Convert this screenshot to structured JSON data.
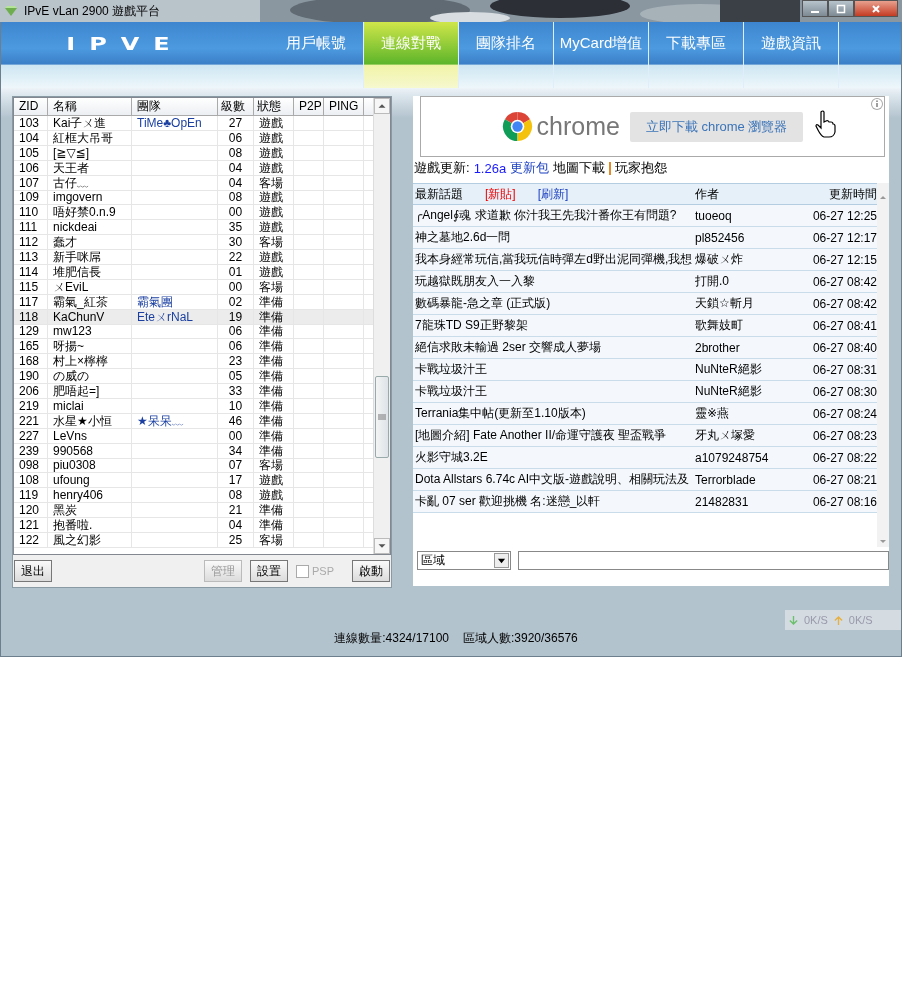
{
  "window": {
    "title": "IPvE vLan 2900 遊戲平台"
  },
  "logo": "IPVE",
  "nav_tabs": [
    {
      "label": "用戶帳號",
      "selected": false
    },
    {
      "label": "連線對戰",
      "selected": true
    },
    {
      "label": "團隊排名",
      "selected": false
    },
    {
      "label": "MyCard增值",
      "selected": false
    },
    {
      "label": "下載專區",
      "selected": false
    },
    {
      "label": "遊戲資訊",
      "selected": false
    }
  ],
  "players": {
    "columns": [
      "ZID",
      "名稱",
      "團隊",
      "級數",
      "狀態",
      "P2P",
      "PING"
    ],
    "rows": [
      {
        "zid": "103",
        "name": "Kai子ㄨ進",
        "team": "TiMe♣OpEn",
        "level": "27",
        "status": "遊戲",
        "selected": false
      },
      {
        "zid": "104",
        "name": "紅框大吊哥",
        "team": "",
        "level": "06",
        "status": "遊戲",
        "selected": false
      },
      {
        "zid": "105",
        "name": "[≧▽≦]",
        "team": "",
        "level": "08",
        "status": "遊戲",
        "selected": false
      },
      {
        "zid": "106",
        "name": "天王者",
        "team": "",
        "level": "04",
        "status": "遊戲",
        "selected": false
      },
      {
        "zid": "107",
        "name": "古仔﹏",
        "team": "",
        "level": "04",
        "status": "客場",
        "selected": false
      },
      {
        "zid": "109",
        "name": "imgovern",
        "team": "",
        "level": "08",
        "status": "遊戲",
        "selected": false
      },
      {
        "zid": "110",
        "name": "唔好禁0.n.9",
        "team": "",
        "level": "00",
        "status": "遊戲",
        "selected": false
      },
      {
        "zid": "111",
        "name": "nickdeai",
        "team": "",
        "level": "35",
        "status": "遊戲",
        "selected": false
      },
      {
        "zid": "112",
        "name": "蠢才",
        "team": "",
        "level": "30",
        "status": "客場",
        "selected": false
      },
      {
        "zid": "113",
        "name": "新手咪屌",
        "team": "",
        "level": "22",
        "status": "遊戲",
        "selected": false
      },
      {
        "zid": "114",
        "name": "堆肥信長",
        "team": "",
        "level": "01",
        "status": "遊戲",
        "selected": false
      },
      {
        "zid": "115",
        "name": "ㄨEviL",
        "team": "",
        "level": "00",
        "status": "客場",
        "selected": false
      },
      {
        "zid": "117",
        "name": "霸氣_紅茶",
        "team": "霸氣團",
        "level": "02",
        "status": "準備",
        "selected": false
      },
      {
        "zid": "118",
        "name": "KaChunV",
        "team": "EteㄨrNaL",
        "level": "19",
        "status": "準備",
        "selected": true
      },
      {
        "zid": "129",
        "name": "mw123",
        "team": "",
        "level": "06",
        "status": "準備",
        "selected": false
      },
      {
        "zid": "165",
        "name": "呀揚~",
        "team": "",
        "level": "06",
        "status": "準備",
        "selected": false
      },
      {
        "zid": "168",
        "name": "村上×檸檸",
        "team": "",
        "level": "23",
        "status": "準備",
        "selected": false
      },
      {
        "zid": "190",
        "name": "の威の",
        "team": "",
        "level": "05",
        "status": "準備",
        "selected": false
      },
      {
        "zid": "206",
        "name": "肥唔起=]",
        "team": "",
        "level": "33",
        "status": "準備",
        "selected": false
      },
      {
        "zid": "219",
        "name": "miclai",
        "team": "",
        "level": "10",
        "status": "準備",
        "selected": false
      },
      {
        "zid": "221",
        "name": "水星★小恒",
        "team": "★呆呆﹏",
        "level": "46",
        "status": "準備",
        "selected": false
      },
      {
        "zid": "227",
        "name": "LeVns",
        "team": "",
        "level": "00",
        "status": "準備",
        "selected": false
      },
      {
        "zid": "239",
        "name": "990568",
        "team": "",
        "level": "34",
        "status": "準備",
        "selected": false
      },
      {
        "zid": "098",
        "name": "piu0308",
        "team": "",
        "level": "07",
        "status": "客場",
        "selected": false
      },
      {
        "zid": "108",
        "name": "ufoung",
        "team": "",
        "level": "17",
        "status": "遊戲",
        "selected": false
      },
      {
        "zid": "119",
        "name": "henry406",
        "team": "",
        "level": "08",
        "status": "遊戲",
        "selected": false
      },
      {
        "zid": "120",
        "name": "黑炭",
        "team": "",
        "level": "21",
        "status": "準備",
        "selected": false
      },
      {
        "zid": "121",
        "name": "抱番啦.",
        "team": "",
        "level": "04",
        "status": "準備",
        "selected": false
      },
      {
        "zid": "122",
        "name": "風之幻影",
        "team": "",
        "level": "25",
        "status": "客場",
        "selected": false
      }
    ]
  },
  "left_buttons": [
    {
      "label": "退出",
      "disabled": false
    },
    {
      "label": "管理",
      "disabled": true
    },
    {
      "label": "設置",
      "disabled": false
    }
  ],
  "psp": {
    "label": "PSP",
    "checked": false,
    "disabled": true
  },
  "start_button": {
    "label": "啟動"
  },
  "ad": {
    "brand": "chrome",
    "button": "立即下載 chrome 瀏覽器"
  },
  "update_line": {
    "label": "遊戲更新:",
    "version": "1.26a",
    "links": [
      "更新包",
      "地圖下載",
      "玩家抱怨"
    ]
  },
  "topics": {
    "header": {
      "title": "最新話題",
      "new_post": "[新貼]",
      "refresh": "[刷新]",
      "author": "作者",
      "time": "更新時間"
    },
    "rows": [
      {
        "title": "╭Angel∮魂 求道歉 你汁我王先我汁番你王有問題?",
        "author": "tuoeoq",
        "time": "06-27 12:25"
      },
      {
        "title": "神之墓地2.6d一問",
        "author": "pl852456",
        "time": "06-27 12:17"
      },
      {
        "title": "我本身經常玩信,當我玩信時彈左d野出泥同彈機,我想",
        "author": "爆破ㄨ炸",
        "time": "06-27 12:15"
      },
      {
        "title": "玩越獄既朋友入一入黎",
        "author": "打開.0",
        "time": "06-27 08:42"
      },
      {
        "title": "數碼暴龍-急之章 (正式版)",
        "author": "天鎖☆斬月",
        "time": "06-27 08:42"
      },
      {
        "title": "7龍珠TD S9正野黎架",
        "author": "歌舞妓町",
        "time": "06-27 08:41"
      },
      {
        "title": "絕信求敗未輸過 2ser 交響成人夢場",
        "author": "2brother",
        "time": "06-27 08:40"
      },
      {
        "title": "卡戰垃圾汁王",
        "author": "NuNteR絕影",
        "time": "06-27 08:31"
      },
      {
        "title": "卡戰垃圾汁王",
        "author": "NuNteR絕影",
        "time": "06-27 08:30"
      },
      {
        "title": "Terrania集中帖(更新至1.10版本)",
        "author": "靈※燕",
        "time": "06-27 08:24"
      },
      {
        "title": "[地圖介紹] Fate Another II/命運守護夜 聖盃戰爭",
        "author": "牙丸ㄨ塚愛",
        "time": "06-27 08:23"
      },
      {
        "title": "火影守城3.2E",
        "author": "a1079248754",
        "time": "06-27 08:22"
      },
      {
        "title": "Dota Allstars 6.74c AI中文版-遊戲說明、相關玩法及",
        "author": "Terrorblade",
        "time": "06-27 08:21"
      },
      {
        "title": "卡亂 07 ser 歡迎挑機 名:迷戀_以軒",
        "author": "21482831",
        "time": "06-27 08:16"
      }
    ]
  },
  "region_select": {
    "value": "區域"
  },
  "speed": {
    "down": "0K/S",
    "up": "0K/S"
  },
  "status_bar": [
    "連線數量:4324/17100",
    "區域人數:3920/36576"
  ]
}
